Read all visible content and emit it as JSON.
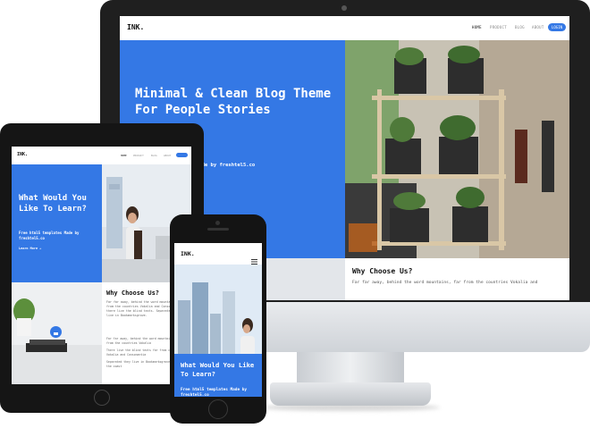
{
  "imac": {
    "logo": "INK.",
    "menu": [
      "HOME",
      "PRODUCT",
      "BLOG",
      "ABOUT"
    ],
    "login_label": "LOGIN",
    "hero_title": "Minimal & Clean Blog Theme For People Stories",
    "hero_byline": "Made by freshtel5.co",
    "section_title": "Why Choose Us?",
    "section_text": "Far far away, behind the word mountains, far from the countries Vokalia and"
  },
  "ipad": {
    "logo": "INK.",
    "menu": [
      "HOME",
      "PRODUCT",
      "BLOG",
      "ABOUT"
    ],
    "hero_title": "What Would You Like To Learn?",
    "hero_sub": "Free html5 templates Made by freshtel5.co",
    "learn_more": "Learn More →",
    "section_title": "Why Choose Us?",
    "section_text": "Far far away, behind the word mountains, far from the countries Vokalia and Consonantia, there live the blind texts. Separated they live in Bookmarksgrove.",
    "list_items": [
      "Far far away, behind the word mountains, far from the countries Vokalia",
      "There live the blind texts far from countries Vokalia and Consonantia",
      "Separated they live in Bookmarksgrove right at the coast"
    ]
  },
  "iphone": {
    "logo": "INK.",
    "hero_title": "What Would You Like To Learn?",
    "hero_sub": "Free html5 templates Made by freshtel5.co"
  },
  "colors": {
    "accent": "#3478e5",
    "device": "#1a1a1a"
  }
}
